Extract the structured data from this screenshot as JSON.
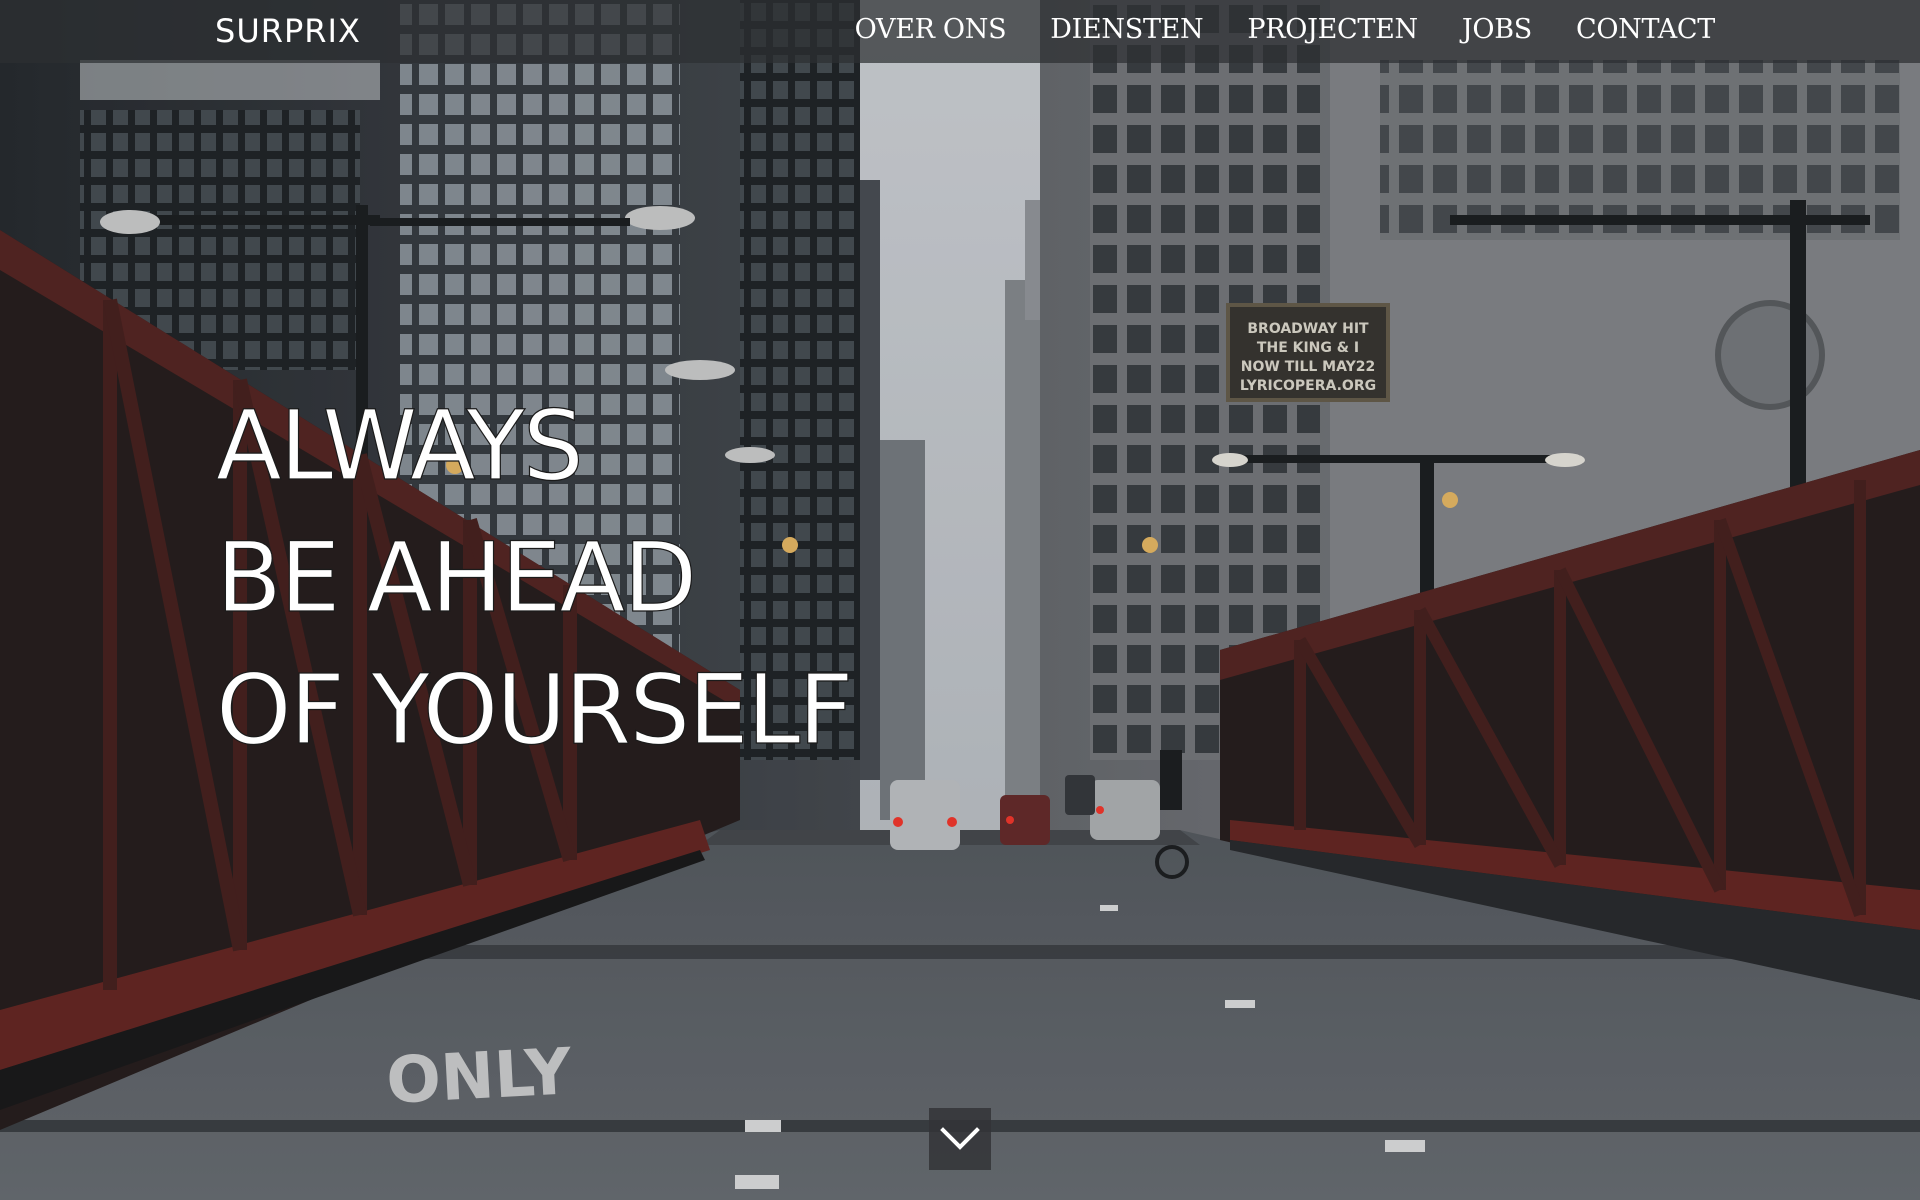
{
  "brand": {
    "logo_text": "SURPRIX"
  },
  "nav": {
    "items": [
      {
        "label": "OVER ONS"
      },
      {
        "label": "DIENSTEN"
      },
      {
        "label": "PROJECTEN"
      },
      {
        "label": "JOBS"
      },
      {
        "label": "CONTACT"
      }
    ]
  },
  "hero": {
    "headline_lines": [
      "ALWAYS",
      "BE AHEAD",
      "OF YOURSELF"
    ],
    "sign_text": [
      "BROADWAY HIT",
      "THE KING & I",
      "NOW TILL MAY22",
      "LYRICOPERA.ORG"
    ],
    "road_text": "ONLY",
    "scroll_icon": "chevron-down-icon"
  },
  "colors": {
    "nav_background": "#2d2f32",
    "text": "#ffffff",
    "bridge_red": "#6b2a26"
  }
}
